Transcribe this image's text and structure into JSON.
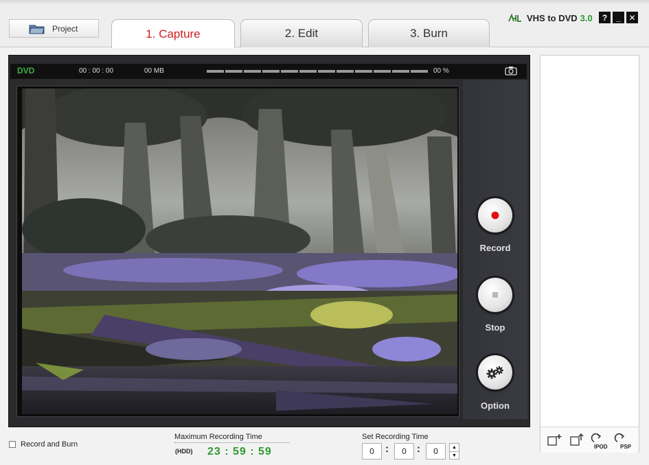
{
  "header": {
    "project_label": "Project",
    "tabs": [
      {
        "label": "1. Capture",
        "active": true
      },
      {
        "label": "2. Edit",
        "active": false
      },
      {
        "label": "3. Burn",
        "active": false
      }
    ],
    "brand": {
      "name": "VHS to DVD",
      "version": "3.0"
    },
    "window_buttons": {
      "help": "?",
      "minimize": "_",
      "close": "✕"
    }
  },
  "status_bar": {
    "format": "DVD",
    "time": "00 : 00 : 00",
    "size": "00 MB",
    "percent": "00 %",
    "progress": 0
  },
  "controls": {
    "record_label": "Record",
    "stop_label": "Stop",
    "option_label": "Option"
  },
  "right_toolbar": {
    "ipod_label": "IPOD",
    "psp_label": "PSP"
  },
  "bottom": {
    "record_and_burn_label": "Record and Burn",
    "record_and_burn_checked": false,
    "max_recording_label": "Maximum Recording Time",
    "hdd_label": "(HDD)",
    "max_recording_time": "23 : 59 : 59",
    "set_recording_label": "Set Recording Time",
    "hours": "0",
    "minutes": "0",
    "seconds": "0"
  },
  "colors": {
    "accent_tab": "#cc1f1f",
    "green_time": "#2d9a2d",
    "panel_dark": "#2b2b2e"
  }
}
